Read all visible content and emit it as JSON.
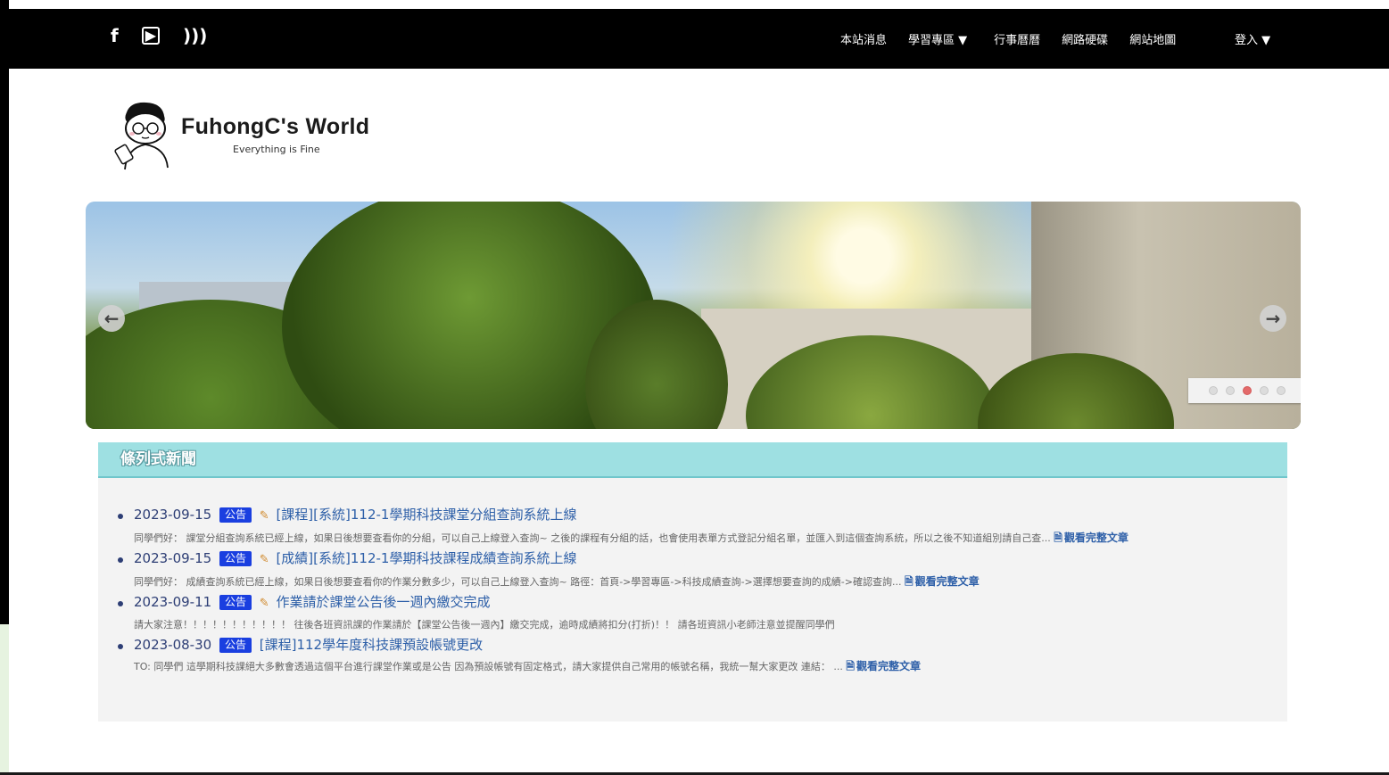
{
  "nav": {
    "social_icons": [
      "facebook-icon",
      "youtube-icon",
      "rss-icon"
    ],
    "links": [
      "本站消息",
      "學習專區 ▼",
      "行事曆曆",
      "網路硬碟",
      "網站地圖"
    ],
    "login": "登入 ▼"
  },
  "logo": {
    "title": "FuhongC's  World",
    "subtitle": "Everything is Fine"
  },
  "carousel": {
    "prev_icon": "arrow-left-icon",
    "next_icon": "arrow-right-icon",
    "slide_count": 5,
    "active_index": 2
  },
  "news": {
    "header": "條列式新聞",
    "read_more": "觀看完整文章",
    "items": [
      {
        "date": "2023-09-15",
        "badge": "公告",
        "title": "[課程][系統]112-1學期科技課堂分組查詢系統上線",
        "summary": "同學們好： 課堂分組查詢系統已經上線，如果日後想要查看你的分組，可以自己上線登入查詢~ 之後的課程有分組的話，也會使用表單方式登記分組名單，並匯入到這個查詢系統，所以之後不知道組別請自己查..."
      },
      {
        "date": "2023-09-15",
        "badge": "公告",
        "title": "[成績][系統]112-1學期科技課程成績查詢系統上線",
        "summary": "同學們好： 成績查詢系統已經上線，如果日後想要查看你的作業分數多少，可以自己上線登入查詢~ 路徑：首頁->學習專區->科技成績查詢->選擇想要查詢的成績->確認查詢..."
      },
      {
        "date": "2023-09-11",
        "badge": "公告",
        "title": "作業請於課堂公告後一週內繳交完成",
        "summary": "請大家注意！！！！！！！！！！！ 往後各班資訊課的作業請於【課堂公告後一週內】繳交完成，逾時成績將扣分(打折)！！ 請各班資訊小老師注意並提醒同學們"
      },
      {
        "date": "2023-08-30",
        "badge": "公告",
        "title": "[課程]112學年度科技課預設帳號更改",
        "summary": "TO: 同學們 這學期科技課絕大多數會透過這個平台進行課堂作業或是公告 因為預設帳號有固定格式，請大家提供自己常用的帳號名稱，我統一幫大家更改 連結： ..."
      }
    ]
  }
}
